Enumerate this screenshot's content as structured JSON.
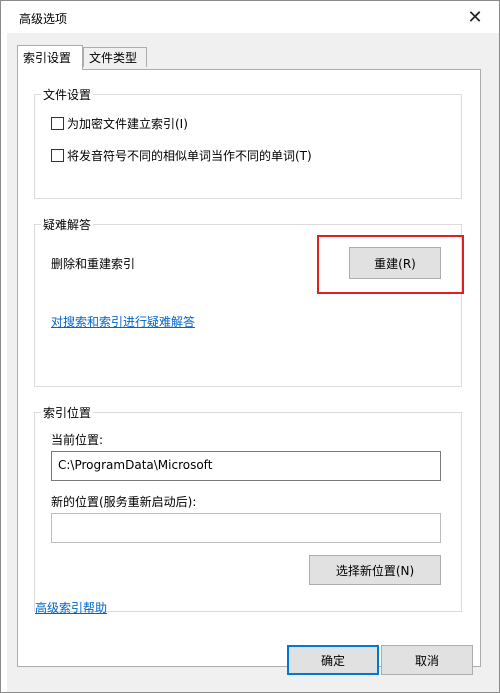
{
  "window": {
    "title": "高级选项",
    "close_glyph": "✕"
  },
  "tabs": [
    {
      "label": "索引设置",
      "active": true
    },
    {
      "label": "文件类型",
      "active": false
    }
  ],
  "file_settings": {
    "legend": "文件设置",
    "options": [
      {
        "label": "为加密文件建立索引(I)",
        "checked": false
      },
      {
        "label": "将发音符号不同的相似单词当作不同的单词(T)",
        "checked": false
      }
    ]
  },
  "troubleshoot": {
    "legend": "疑难解答",
    "rebuild_text": "删除和重建索引",
    "rebuild_button": "重建(R)",
    "link": "对搜索和索引进行疑难解答"
  },
  "index_location": {
    "legend": "索引位置",
    "current_label": "当前位置:",
    "current_value": "C:\\ProgramData\\Microsoft",
    "new_label": "新的位置(服务重新启动后):",
    "new_value": "",
    "select_button": "选择新位置(N)"
  },
  "help_link": "高级索引帮助",
  "footer": {
    "ok": "确定",
    "cancel": "取消"
  },
  "colors": {
    "highlight": "#e02020",
    "link": "#0066cc",
    "default_button_border": "#0078d7"
  }
}
